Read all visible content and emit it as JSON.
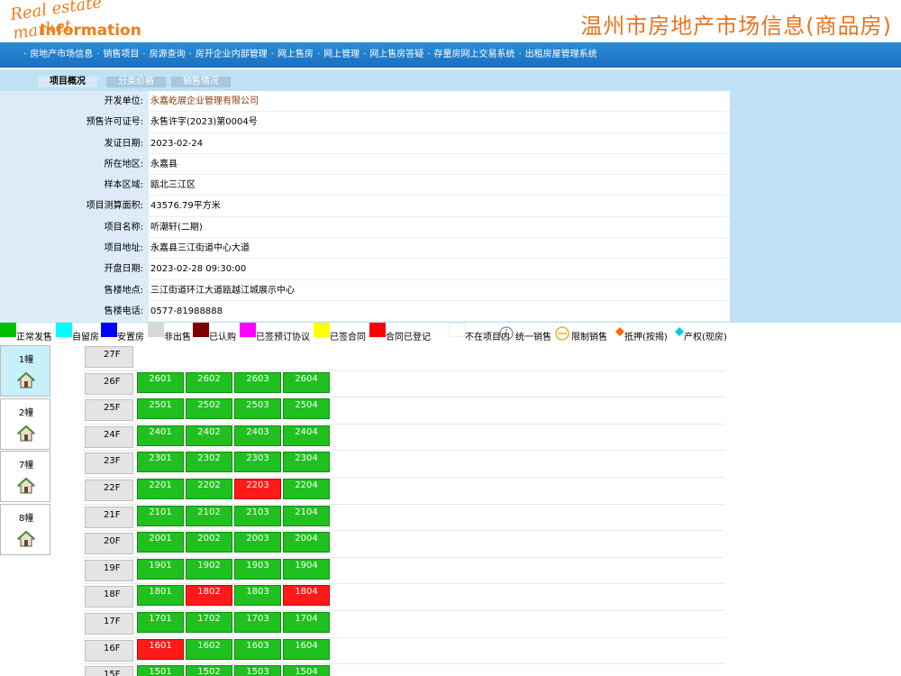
{
  "header": {
    "logo_line1": "Real estate market",
    "logo_line2": "Information",
    "site_title": "温州市房地产市场信息(商品房)"
  },
  "nav": {
    "items": [
      "房地产市场信息",
      "销售项目",
      "房源查询",
      "房开企业内部管理",
      "网上售房",
      "网上管理",
      "网上售房答疑",
      "存量房网上交易系统",
      "出租房屋管理系统"
    ]
  },
  "tabs": [
    "项目概况",
    "分类价格",
    "销售情况"
  ],
  "info": [
    {
      "label": "开发单位:",
      "value": "永嘉屹展企业管理有限公司"
    },
    {
      "label": "预售许可证号:",
      "value": "永售许字(2023)第0004号"
    },
    {
      "label": "发证日期:",
      "value": "2023-02-24"
    },
    {
      "label": "所在地区:",
      "value": "永嘉县"
    },
    {
      "label": "样本区域:",
      "value": "瓯北三江区"
    },
    {
      "label": "项目测算面积:",
      "value": "43576.79平方米"
    },
    {
      "label": "项目名称:",
      "value": "听潮轩(二期)"
    },
    {
      "label": "项目地址:",
      "value": "永嘉县三江街道中心大道"
    },
    {
      "label": "开盘日期:",
      "value": "2023-02-28 09:30:00"
    },
    {
      "label": "售楼地点:",
      "value": "三江街道环江大道瓯越江城展示中心"
    },
    {
      "label": "售楼电话:",
      "value": "0577-81988888"
    }
  ],
  "legend": [
    {
      "label": "正常发售",
      "color": "#00c000",
      "icon": "swatch"
    },
    {
      "label": "自留房",
      "color": "#00ffff",
      "icon": "swatch"
    },
    {
      "label": "安置房",
      "color": "#0000ff",
      "icon": "swatch"
    },
    {
      "label": "非出售",
      "color": "#d8d8d8",
      "icon": "swatch"
    },
    {
      "label": "已认购",
      "color": "#800000",
      "icon": "swatch"
    },
    {
      "label": "已签预订协议",
      "color": "#ff00ff",
      "icon": "swatch"
    },
    {
      "label": "已签合同",
      "color": "#ffff00",
      "icon": "swatch"
    },
    {
      "label": "合同已登记",
      "color": "#ff0000",
      "icon": "swatch"
    },
    {
      "label": "不在项目内",
      "color": "#ffffff",
      "icon": "swatch"
    },
    {
      "label": "统一销售",
      "color": "#888888",
      "icon": "info-circle-icon"
    },
    {
      "label": "限制销售",
      "color": "#e8a000",
      "icon": "minus-circle-icon"
    },
    {
      "label": "抵押(按揭)",
      "color": "#ff6600",
      "icon": "diamond-icon"
    },
    {
      "label": "产权(现房)",
      "color": "#00c8e8",
      "icon": "diamond-icon"
    }
  ],
  "buildings": [
    {
      "name": "1幢",
      "active": true
    },
    {
      "name": "2幢",
      "active": false
    },
    {
      "name": "7幢",
      "active": false
    },
    {
      "name": "8幢",
      "active": false
    }
  ],
  "floors": [
    {
      "label": "27F",
      "units": []
    },
    {
      "label": "26F",
      "units": [
        {
          "no": "2601",
          "status": "green"
        },
        {
          "no": "2602",
          "status": "green"
        },
        {
          "no": "2603",
          "status": "green"
        },
        {
          "no": "2604",
          "status": "green"
        }
      ]
    },
    {
      "label": "25F",
      "units": [
        {
          "no": "2501",
          "status": "green"
        },
        {
          "no": "2502",
          "status": "green"
        },
        {
          "no": "2503",
          "status": "green"
        },
        {
          "no": "2504",
          "status": "green"
        }
      ]
    },
    {
      "label": "24F",
      "units": [
        {
          "no": "2401",
          "status": "green"
        },
        {
          "no": "2402",
          "status": "green"
        },
        {
          "no": "2403",
          "status": "green"
        },
        {
          "no": "2404",
          "status": "green"
        }
      ]
    },
    {
      "label": "23F",
      "units": [
        {
          "no": "2301",
          "status": "green"
        },
        {
          "no": "2302",
          "status": "green"
        },
        {
          "no": "2303",
          "status": "green"
        },
        {
          "no": "2304",
          "status": "green"
        }
      ]
    },
    {
      "label": "22F",
      "units": [
        {
          "no": "2201",
          "status": "green"
        },
        {
          "no": "2202",
          "status": "green"
        },
        {
          "no": "2203",
          "status": "red"
        },
        {
          "no": "2204",
          "status": "green"
        }
      ]
    },
    {
      "label": "21F",
      "units": [
        {
          "no": "2101",
          "status": "green"
        },
        {
          "no": "2102",
          "status": "green"
        },
        {
          "no": "2103",
          "status": "green"
        },
        {
          "no": "2104",
          "status": "green"
        }
      ]
    },
    {
      "label": "20F",
      "units": [
        {
          "no": "2001",
          "status": "green"
        },
        {
          "no": "2002",
          "status": "green"
        },
        {
          "no": "2003",
          "status": "green"
        },
        {
          "no": "2004",
          "status": "green"
        }
      ]
    },
    {
      "label": "19F",
      "units": [
        {
          "no": "1901",
          "status": "green"
        },
        {
          "no": "1902",
          "status": "green"
        },
        {
          "no": "1903",
          "status": "green"
        },
        {
          "no": "1904",
          "status": "green"
        }
      ]
    },
    {
      "label": "18F",
      "units": [
        {
          "no": "1801",
          "status": "green"
        },
        {
          "no": "1802",
          "status": "red"
        },
        {
          "no": "1803",
          "status": "green"
        },
        {
          "no": "1804",
          "status": "red"
        }
      ]
    },
    {
      "label": "17F",
      "units": [
        {
          "no": "1701",
          "status": "green"
        },
        {
          "no": "1702",
          "status": "green"
        },
        {
          "no": "1703",
          "status": "green"
        },
        {
          "no": "1704",
          "status": "green"
        }
      ]
    },
    {
      "label": "16F",
      "units": [
        {
          "no": "1601",
          "status": "red"
        },
        {
          "no": "1602",
          "status": "green"
        },
        {
          "no": "1603",
          "status": "green"
        },
        {
          "no": "1604",
          "status": "green"
        }
      ]
    },
    {
      "label": "15F",
      "units": [
        {
          "no": "1501",
          "status": "green"
        },
        {
          "no": "1502",
          "status": "green"
        },
        {
          "no": "1503",
          "status": "green"
        },
        {
          "no": "1504",
          "status": "green"
        }
      ]
    }
  ]
}
